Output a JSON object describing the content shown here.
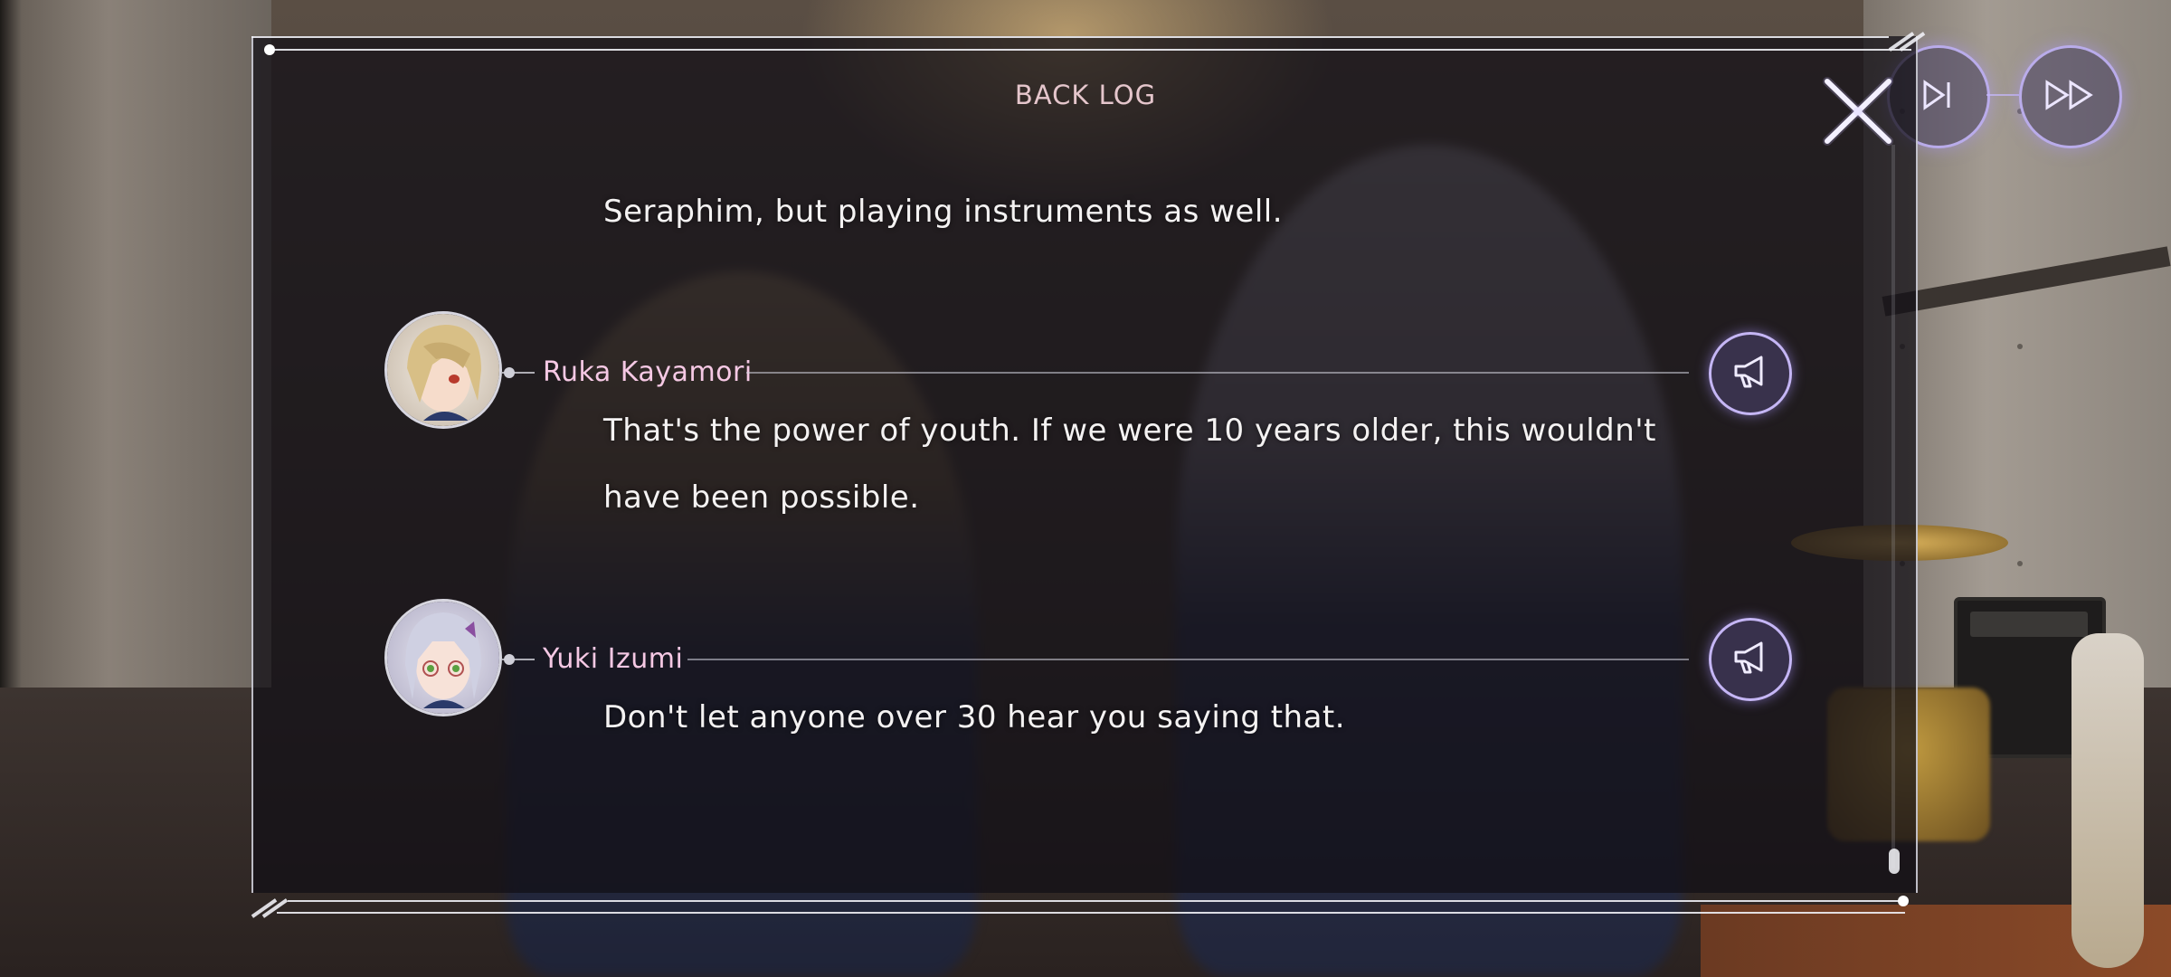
{
  "backlog": {
    "title": "BACK LOG",
    "close_icon": "close-x-icon"
  },
  "controls": {
    "skip_icon": "skip-to-end-icon",
    "fast_forward_icon": "fast-forward-icon"
  },
  "entries": [
    {
      "speaker": "",
      "lines": [
        "Seraphim, but playing instruments as well."
      ]
    },
    {
      "speaker": "Ruka Kayamori",
      "avatar_icon": "ruka-kayamori-avatar",
      "voice_icon": "megaphone-icon",
      "lines": [
        "That's the power of youth. If we were 10 years older, this wouldn't",
        "have been possible."
      ]
    },
    {
      "speaker": "Yuki Izumi",
      "avatar_icon": "yuki-izumi-avatar",
      "voice_icon": "megaphone-icon",
      "lines": [
        "Don't let anyone over 30 hear you saying that."
      ]
    }
  ],
  "colors": {
    "accent": "#c8b9ff",
    "name": "#f5c8e4",
    "title": "#e5c6cc"
  }
}
